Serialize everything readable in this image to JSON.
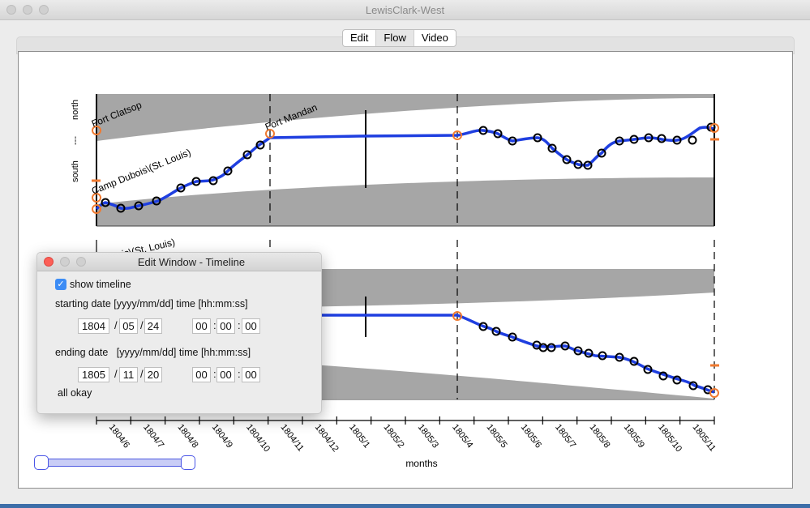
{
  "window": {
    "title": "LewisClark-West"
  },
  "toolbar": {
    "tabs": [
      "Edit",
      "Flow",
      "Video"
    ],
    "selected": "Flow"
  },
  "chart_data": {
    "type": "line",
    "xlabel": "months",
    "x_ticks": [
      "1804/6",
      "1804/7",
      "1804/8",
      "1804/9",
      "1804/10",
      "1804/11",
      "1804/12",
      "1805/1",
      "1805/2",
      "1805/3",
      "1805/4",
      "1805/5",
      "1805/6",
      "1805/7",
      "1805/8",
      "1805/9",
      "1805/10",
      "1805/11"
    ],
    "upper_panel": {
      "y_labels": [
        "north",
        "---",
        "south"
      ],
      "locations": [
        "Fort Clatsop",
        "Camp Dubois\\(St. Louis)",
        "Fort Mandan"
      ]
    },
    "lower_panel": {
      "partial_location_label": "ois\\(St. Louis)"
    }
  },
  "edit_window": {
    "title": "Edit Window - Timeline",
    "show_timeline_label": "show timeline",
    "show_timeline_checked": true,
    "start_label": "starting date [yyyy/mm/dd] time [hh:mm:ss]",
    "end_label": "ending date   [yyyy/mm/dd] time [hh:mm:ss]",
    "start": {
      "year": "1804",
      "month": "05",
      "day": "24",
      "hh": "00",
      "mm": "00",
      "ss": "00"
    },
    "end": {
      "year": "1805",
      "month": "11",
      "day": "20",
      "hh": "00",
      "mm": "00",
      "ss": "00"
    },
    "date_sep": "/",
    "time_sep": ":",
    "status": "all okay"
  },
  "colors": {
    "line": "#1f3fe0",
    "marker": "#000000",
    "highlight": "#f07a30",
    "band": "#a6a6a6"
  }
}
